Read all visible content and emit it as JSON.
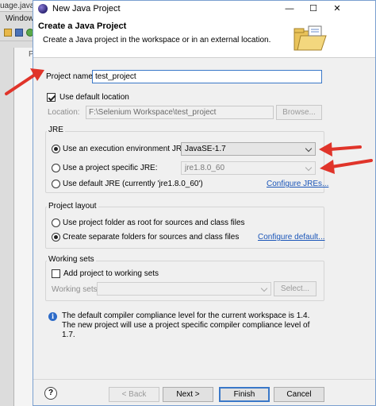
{
  "background": {
    "tab_text": "uage.java -",
    "menu_text": "Window",
    "pane_text": "P"
  },
  "titlebar": {
    "title": "New Java Project",
    "minimize": "—",
    "maximize": "☐",
    "close": "✕"
  },
  "header": {
    "title": "Create a Java Project",
    "description": "Create a Java project in the workspace or in an external location."
  },
  "project": {
    "name_label": "Project name:",
    "name_value": "test_project",
    "use_default_location_label": "Use default location",
    "use_default_location_checked": true,
    "location_label": "Location:",
    "location_value": "F:\\Selenium Workspace\\test_project",
    "browse_label": "Browse..."
  },
  "jre": {
    "group_title": "JRE",
    "option_env_label": "Use an execution environment JRE:",
    "option_env_value": "JavaSE-1.7",
    "option_specific_label": "Use a project specific JRE:",
    "option_specific_value": "jre1.8.0_60",
    "option_default_label": "Use default JRE (currently 'jre1.8.0_60')",
    "configure_link": "Configure JREs...",
    "selected": "env"
  },
  "layout": {
    "group_title": "Project layout",
    "option_root_label": "Use project folder as root for sources and class files",
    "option_separate_label": "Create separate folders for sources and class files",
    "configure_link": "Configure default...",
    "selected": "separate"
  },
  "working_sets": {
    "group_title": "Working sets",
    "add_label": "Add project to working sets",
    "add_checked": false,
    "sets_label": "Working sets:",
    "select_label": "Select..."
  },
  "info": {
    "message": "The default compiler compliance level for the current workspace is 1.4. The new project will use a project specific compiler compliance level of 1.7."
  },
  "footer": {
    "help_icon": "?",
    "back_label": "< Back",
    "next_label": "Next >",
    "finish_label": "Finish",
    "cancel_label": "Cancel"
  },
  "colors": {
    "annotation_arrow": "#e0342a",
    "link": "#1a55b8",
    "focus_border": "#3a78c8"
  }
}
